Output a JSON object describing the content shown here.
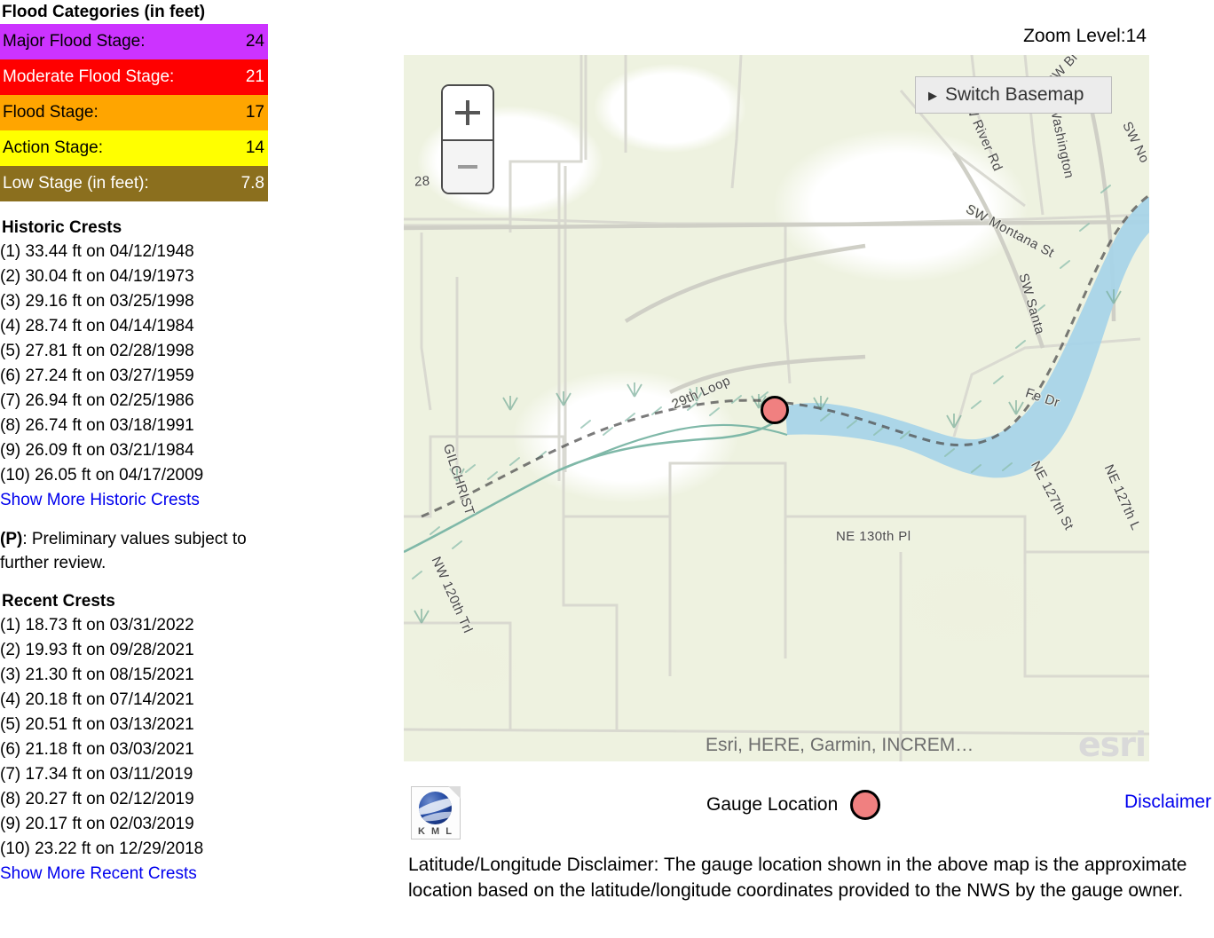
{
  "flood_categories": {
    "heading": "Flood Categories (in feet)",
    "rows": [
      {
        "label": "Major Flood Stage:",
        "value": "24",
        "bg": "#CC33FF",
        "fg": "#000000"
      },
      {
        "label": "Moderate Flood Stage:",
        "value": "21",
        "bg": "#FF0000",
        "fg": "#FFFFFF"
      },
      {
        "label": "Flood Stage:",
        "value": "17",
        "bg": "#FFA500",
        "fg": "#000000"
      },
      {
        "label": "Action Stage:",
        "value": "14",
        "bg": "#FFFF00",
        "fg": "#000000"
      },
      {
        "label": "Low Stage (in feet):",
        "value": "7.8",
        "bg": "#8B6F1E",
        "fg": "#FFFFFF"
      }
    ]
  },
  "historic_crests": {
    "heading": "Historic Crests",
    "items": [
      "(1) 33.44 ft on 04/12/1948",
      "(2) 30.04 ft on 04/19/1973",
      "(3) 29.16 ft on 03/25/1998",
      "(4) 28.74 ft on 04/14/1984",
      "(5) 27.81 ft on 02/28/1998",
      "(6) 27.24 ft on 03/27/1959",
      "(7) 26.94 ft on 02/25/1986",
      "(8) 26.74 ft on 03/18/1991",
      "(9) 26.09 ft on 03/21/1984",
      "(10) 26.05 ft on 04/17/2009"
    ],
    "show_more": "Show More Historic Crests"
  },
  "preliminary_note": {
    "prefix": "(P)",
    "text": ": Preliminary values subject to further review."
  },
  "recent_crests": {
    "heading": "Recent Crests",
    "items": [
      "(1) 18.73 ft on 03/31/2022",
      "(2) 19.93 ft on 09/28/2021",
      "(3) 21.30 ft on 08/15/2021",
      "(4) 20.18 ft on 07/14/2021",
      "(5) 20.51 ft on 03/13/2021",
      "(6) 21.18 ft on 03/03/2021",
      "(7) 17.34 ft on 03/11/2019",
      "(8) 20.27 ft on 02/12/2019",
      "(9) 20.17 ft on 02/03/2019",
      "(10) 23.22 ft on 12/29/2018"
    ],
    "show_more": "Show More Recent Crests"
  },
  "map": {
    "zoom_level_label": "Zoom Level:14",
    "switch_basemap_label": "Switch Basemap",
    "switch_basemap_caret": "▶",
    "zoom_in_icon": "plus-icon",
    "zoom_out_icon": "minus-icon",
    "attribution": "Esri, HERE, Garmin, INCREM…",
    "esri_logo_text": "esri",
    "street_labels": [
      "28",
      "SW River Rd",
      "Washington",
      "SW Montana St",
      "SW No",
      "SW Bl",
      "29th Loop",
      "SW Santa",
      "Fe Dr",
      "GILCHRIST",
      "NW 120th Trl",
      "NE 130th Pl",
      "NE 127th St",
      "NE 127th L"
    ],
    "marker_color": "#F08080"
  },
  "legend": {
    "kml_icon_name": "kml-file-icon",
    "kml_icon_text": "K M L",
    "gauge_location_label": "Gauge Location",
    "disclaimer_link": "Disclaimer"
  },
  "disclaimer_paragraph": "Latitude/Longitude Disclaimer: The gauge location shown in the above map is the approximate location based on the latitude/longitude coordinates provided to the NWS by the gauge owner."
}
